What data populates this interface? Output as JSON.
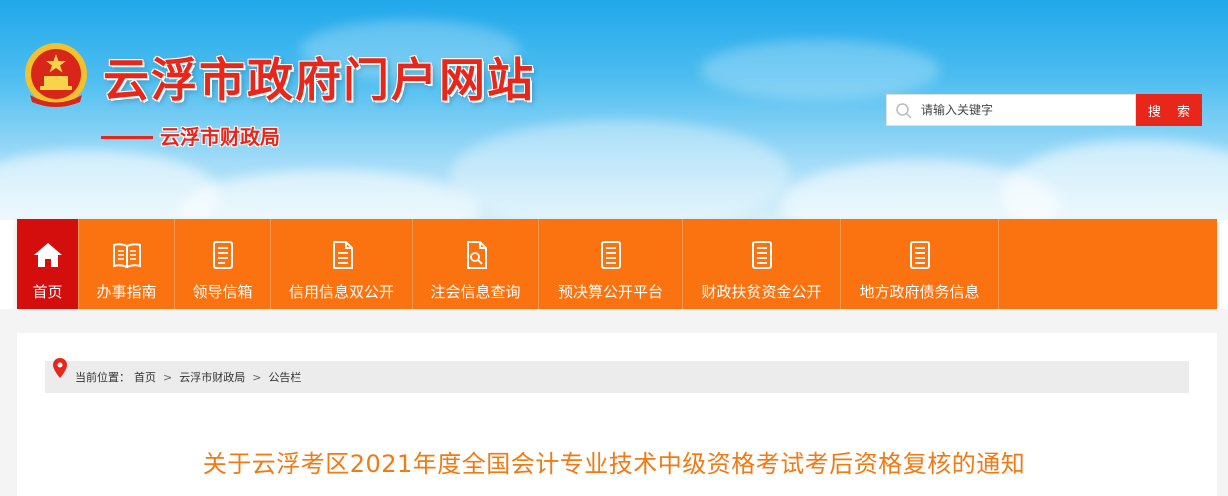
{
  "header": {
    "site_title": "云浮市政府门户网站",
    "subtitle": "云浮市财政局",
    "emblem_icon": "national-emblem-icon"
  },
  "search": {
    "placeholder": "请输入关键字",
    "button_label": "搜 索",
    "icon": "search-icon"
  },
  "nav": {
    "items": [
      {
        "label": "首页",
        "icon": "home-icon",
        "active": true
      },
      {
        "label": "办事指南",
        "icon": "book-icon"
      },
      {
        "label": "领导信箱",
        "icon": "document-icon"
      },
      {
        "label": "信用信息双公开",
        "icon": "document-icon"
      },
      {
        "label": "注会信息查询",
        "icon": "document-icon"
      },
      {
        "label": "预决算公开平台",
        "icon": "document-icon"
      },
      {
        "label": "财政扶贫资金公开",
        "icon": "document-icon"
      },
      {
        "label": "地方政府债务信息",
        "icon": "document-icon"
      }
    ]
  },
  "breadcrumb": {
    "prefix": "当前位置：",
    "items": [
      "首页",
      "云浮市财政局",
      "公告栏"
    ],
    "separator": ">"
  },
  "article": {
    "title": "关于云浮考区2021年度全国会计专业技术中级资格考试考后资格复核的通知"
  },
  "colors": {
    "brand_red": "#e8261a",
    "nav_orange": "#fb7310",
    "active_red": "#d40d0d",
    "title_orange": "#f07a14"
  }
}
